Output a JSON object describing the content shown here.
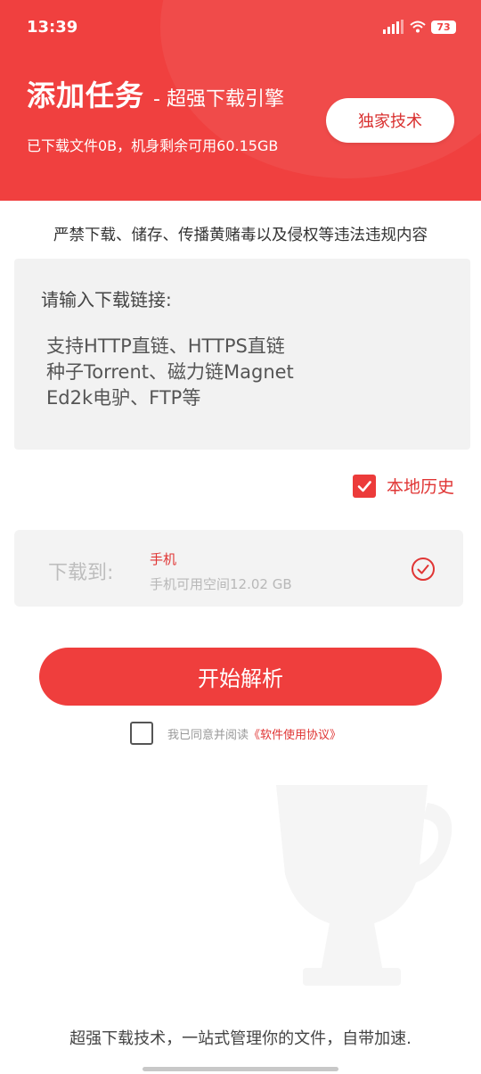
{
  "status": {
    "time": "13:39",
    "battery": "73",
    "icons": [
      "signal-icon",
      "wifi-icon",
      "battery-icon"
    ]
  },
  "header": {
    "title": "添加任务",
    "subtitle": "- 超强下载引擎",
    "storage": "已下载文件0B，机身剩余可用60.15GB",
    "exclusive_button": "独家技术"
  },
  "warning": "严禁下载、储存、传播黄赌毒以及侵权等违法违规内容",
  "link_input": {
    "label": "请输入下载链接:",
    "placeholder_lines": [
      "支持HTTP直链、HTTPS直链",
      "种子Torrent、磁力链Magnet",
      "Ed2k电驴、FTP等"
    ]
  },
  "history": {
    "label": "本地历史",
    "checked": true
  },
  "destination": {
    "label": "下载到:",
    "name": "手机",
    "space": "手机可用空间12.02 GB",
    "selected": true
  },
  "start_button": "开始解析",
  "agreement": {
    "checked": false,
    "text": "我已同意并阅读",
    "link": "《软件使用协议》"
  },
  "footer": "超强下载技术，一站式管理你的文件，自带加速.",
  "colors": {
    "brand_red": "#f0403f",
    "accent_red": "#e03534",
    "panel_gray": "#f2f2f2"
  }
}
